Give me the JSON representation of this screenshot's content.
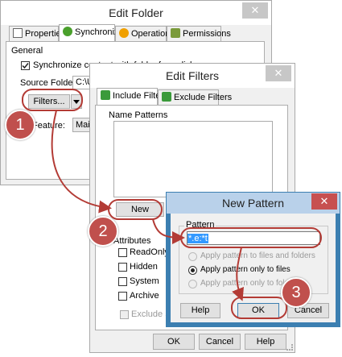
{
  "edit_folder": {
    "title": "Edit Folder",
    "close": "✕",
    "tabs": [
      "Properties",
      "Synchronize",
      "Operations",
      "Permissions"
    ],
    "general_label": "General",
    "sync_checkbox": "Synchronize content with folder from disk",
    "source_folder_label": "Source Folder:",
    "source_folder_value": "C:\\Us",
    "filters_button": "Filters...",
    "feature_label": "Feature:",
    "feature_value": "MainF"
  },
  "edit_filters": {
    "title": "Edit Filters",
    "close": "✕",
    "tabs": [
      "Include Filters",
      "Exclude Filters"
    ],
    "name_patterns_label": "Name Patterns",
    "new_button": "New",
    "attributes_label": "Attributes",
    "attributes": [
      "ReadOnly",
      "Hidden",
      "System",
      "Archive"
    ],
    "exclude_subfolders": "Exclude Subfolders",
    "ok": "OK",
    "cancel": "Cancel",
    "help": "Help"
  },
  "new_pattern": {
    "title": "New Pattern",
    "close": "✕",
    "pattern_label": "Pattern",
    "pattern_value": "*.e:*t",
    "options": [
      "Apply pattern to files and folders",
      "Apply pattern only to files",
      "Apply pattern only to folders"
    ],
    "help": "Help",
    "ok": "OK",
    "cancel": "Cancel"
  },
  "steps": [
    "1",
    "2",
    "3"
  ],
  "colors": {
    "accent_red": "#b33b35",
    "badge_red": "#c0504d",
    "close_red": "#c75050",
    "pattern_blue": "#3399ff"
  }
}
